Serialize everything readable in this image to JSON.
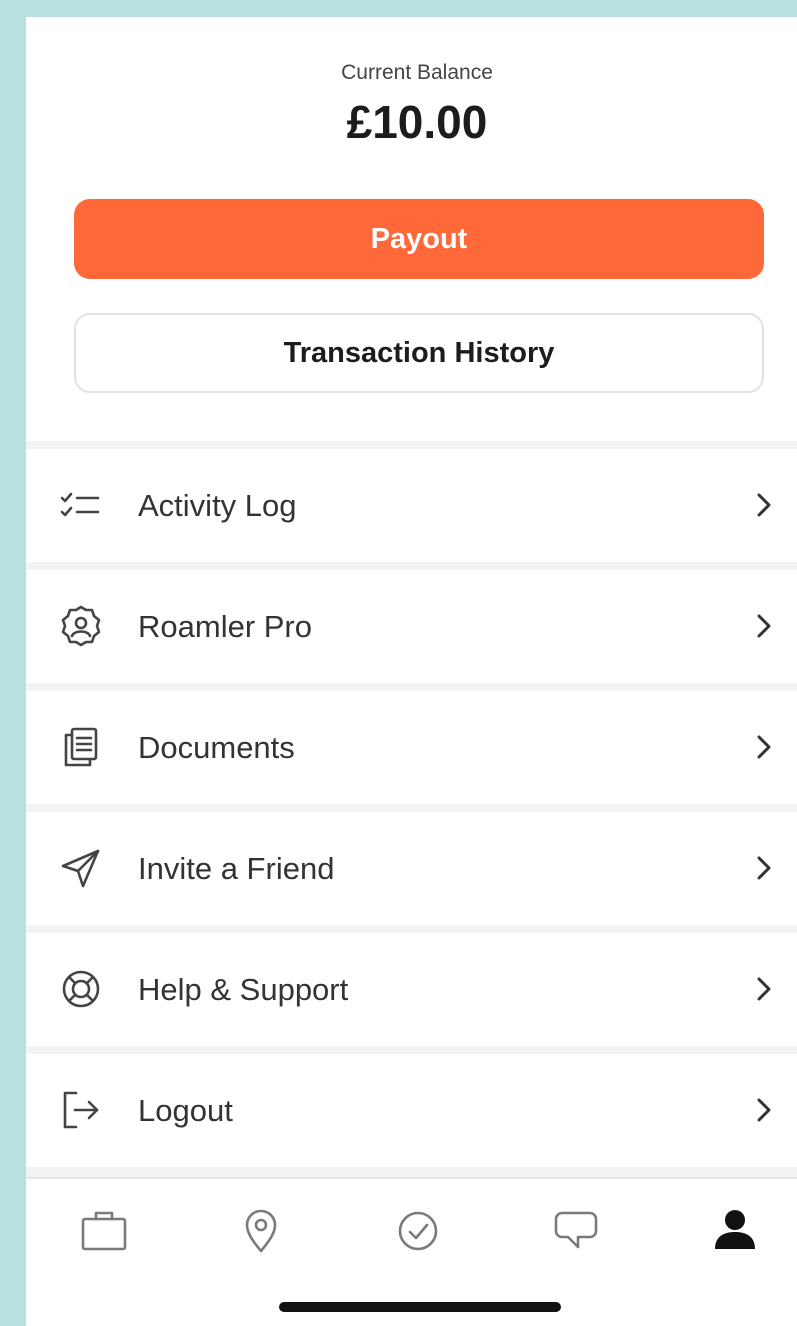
{
  "balance": {
    "label": "Current Balance",
    "amount": "£10.00"
  },
  "buttons": {
    "payout": "Payout",
    "transaction_history": "Transaction History"
  },
  "menu": [
    {
      "label": "Activity Log",
      "icon": "checklist-icon"
    },
    {
      "label": "Roamler Pro",
      "icon": "badge-user-icon"
    },
    {
      "label": "Documents",
      "icon": "documents-icon"
    },
    {
      "label": "Invite a Friend",
      "icon": "send-icon"
    },
    {
      "label": "Help & Support",
      "icon": "lifebuoy-icon"
    },
    {
      "label": "Logout",
      "icon": "logout-icon"
    }
  ],
  "tabbar": {
    "tabs": [
      "briefcase-icon",
      "location-pin-icon",
      "check-circle-icon",
      "chat-bubble-icon",
      "person-icon"
    ],
    "active": "person-icon"
  },
  "colors": {
    "accent": "#ff6839",
    "page_background": "#b7e0df",
    "text": "#333333"
  }
}
